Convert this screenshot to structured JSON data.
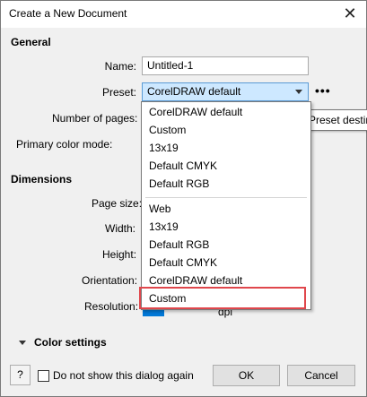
{
  "window": {
    "title": "Create a New Document",
    "close_glyph": "✕"
  },
  "sections": {
    "general": "General",
    "dimensions": "Dimensions"
  },
  "fields": {
    "name_label": "Name:",
    "name_value": "Untitled-1",
    "preset_label": "Preset:",
    "preset_value": "CorelDRAW default",
    "pages_label": "Number of pages:",
    "color_mode_label": "Primary color mode:",
    "page_size_label": "Page size:",
    "width_label": "Width:",
    "height_label": "Height:",
    "orientation_label": "Orientation:",
    "resolution_label": "Resolution:",
    "resolution_units": "dpi"
  },
  "more_glyph": "•••",
  "tooltip": "Preset destin",
  "dropdown": {
    "group1": [
      "CorelDRAW default",
      "Custom",
      "13x19",
      "Default CMYK",
      "Default RGB"
    ],
    "group2": [
      "Web",
      "13x19",
      "Default RGB",
      "Default CMYK",
      "CorelDRAW default",
      "Custom"
    ],
    "highlight_color": "#e0474c"
  },
  "footer": {
    "color_settings": "Color settings",
    "help": "?",
    "dont_show": "Do not show this dialog again",
    "ok": "OK",
    "cancel": "Cancel"
  }
}
